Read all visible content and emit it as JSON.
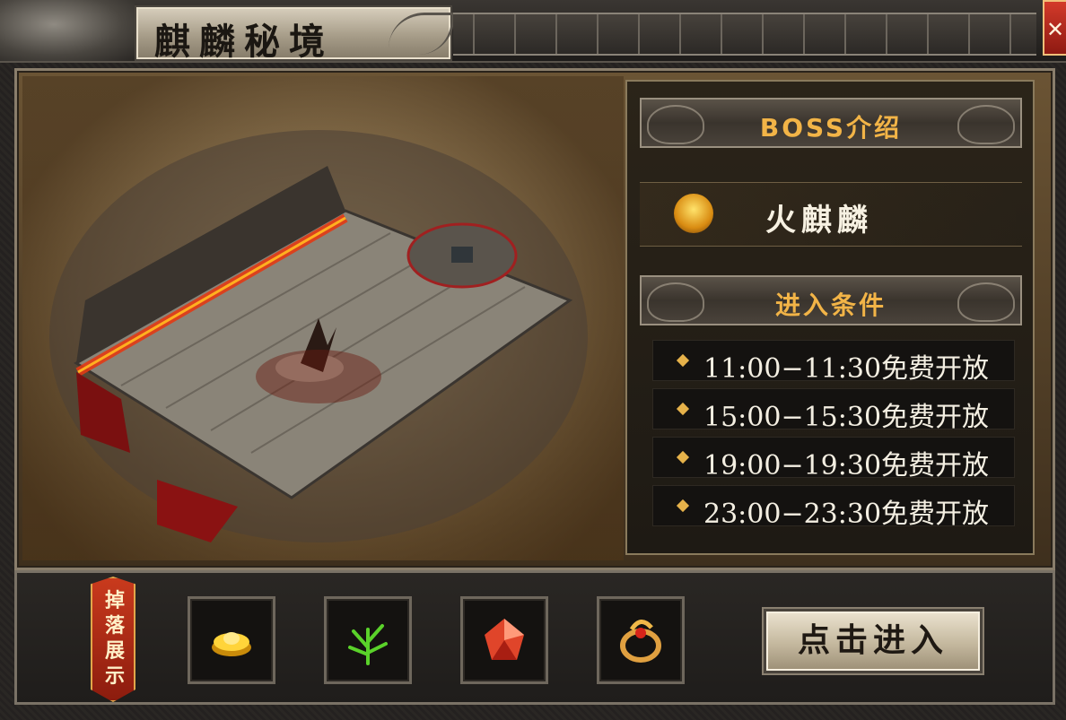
{
  "window": {
    "title": "麒麟秘境",
    "close_label": "✕"
  },
  "map": {
    "icon": "dungeon-map-image"
  },
  "boss": {
    "header": "BOSS介绍",
    "name": "火麒麟",
    "emblem_icon": "qilin-emblem-icon"
  },
  "conditions": {
    "header": "进入条件",
    "times": [
      "11:00−11:30免费开放",
      "15:00−15:30免费开放",
      "19:00−19:30免费开放",
      "23:00−23:30免费开放"
    ]
  },
  "drops": {
    "label": "掉落展示",
    "items": [
      {
        "icon": "gold-ingot-icon"
      },
      {
        "icon": "herb-icon"
      },
      {
        "icon": "red-gem-icon"
      },
      {
        "icon": "ring-icon"
      }
    ],
    "enter_label": "点击进入"
  },
  "colors": {
    "accent_gold": "#f2b447",
    "close_red": "#c93a1d"
  }
}
